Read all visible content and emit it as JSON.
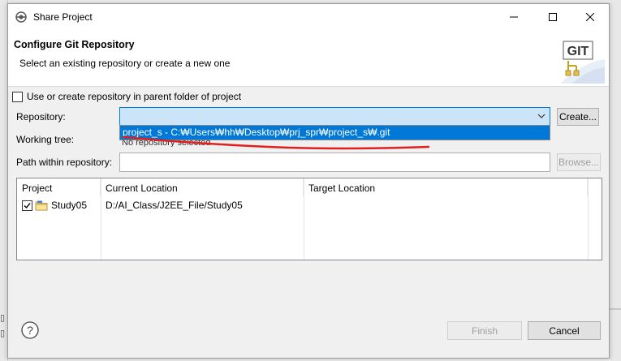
{
  "window": {
    "title": "Share Project"
  },
  "header": {
    "title": "Configure Git Repository",
    "description": "Select an existing repository or create a new one",
    "logo_text": "GIT"
  },
  "options": {
    "parent_folder_label": "Use or create repository in parent folder of project",
    "parent_folder_checked": false
  },
  "form": {
    "repository_label": "Repository:",
    "repository_value": "",
    "repository_option": "project_s - C:₩Users₩hh₩Desktop₩prj_spr₩project_s₩.git",
    "working_tree_label": "Working tree:",
    "working_tree_value": "No repository selected",
    "path_label": "Path within repository:",
    "path_value": "",
    "create_label": "Create...",
    "browse_label": "Browse..."
  },
  "table": {
    "columns": [
      "Project",
      "Current Location",
      "Target Location"
    ],
    "rows": [
      {
        "checked": true,
        "project": "Study05",
        "current_location": "D:/AI_Class/J2EE_File/Study05",
        "target_location": ""
      }
    ]
  },
  "footer": {
    "finish_label": "Finish",
    "cancel_label": "Cancel"
  },
  "colors": {
    "accent": "#0078d7",
    "selection_bg": "#cce4f7",
    "annotation_red": "#e02020"
  }
}
